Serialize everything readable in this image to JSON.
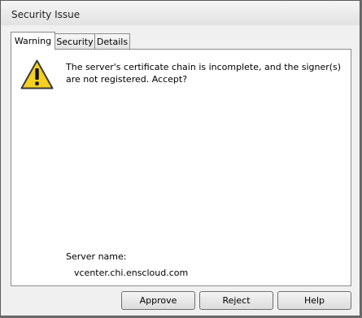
{
  "window": {
    "title": "Security Issue"
  },
  "tabs": [
    {
      "label": "Warning",
      "active": true
    },
    {
      "label": "Security",
      "active": false
    },
    {
      "label": "Details",
      "active": false
    }
  ],
  "warning": {
    "icon": "warning-triangle-icon",
    "message": "The server's certificate chain is incomplete, and the signer(s) are not registered. Accept?",
    "server_name_label": "Server name:",
    "server_name_value": "vcenter.chi.enscloud.com"
  },
  "buttons": {
    "approve": "Approve",
    "reject": "Reject",
    "help": "Help"
  },
  "colors": {
    "warning_yellow": "#f4d020",
    "warning_border": "#3a3a3a"
  }
}
